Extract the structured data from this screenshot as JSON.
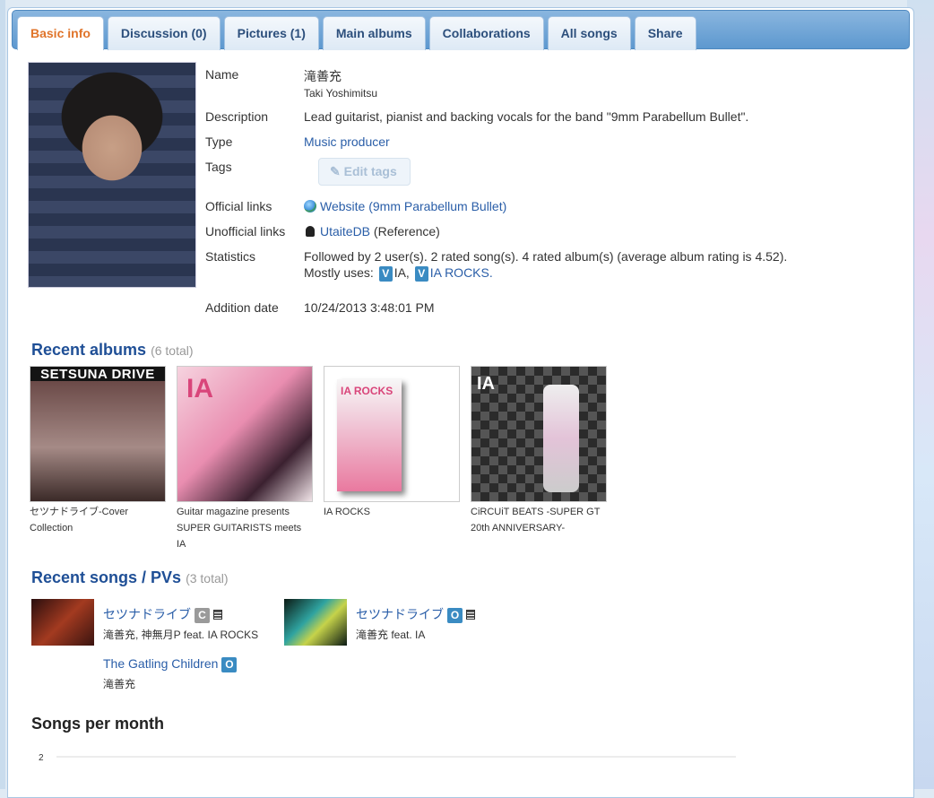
{
  "tabs": [
    "Basic info",
    "Discussion (0)",
    "Pictures (1)",
    "Main albums",
    "Collaborations",
    "All songs",
    "Share"
  ],
  "info": {
    "name_label": "Name",
    "name": "滝善充",
    "name_romaji": "Taki Yoshimitsu",
    "description_label": "Description",
    "description": "Lead guitarist, pianist and backing vocals for the band \"9mm Parabellum Bullet\".",
    "type_label": "Type",
    "type": "Music producer",
    "tags_label": "Tags",
    "edit_tags": "Edit tags",
    "official_links_label": "Official links",
    "official_link": "Website (9mm Parabellum Bullet)",
    "unofficial_links_label": "Unofficial links",
    "unofficial_link": "UtaiteDB",
    "unofficial_link_note": "(Reference)",
    "statistics_label": "Statistics",
    "statistics": "Followed by 2 user(s). 2 rated song(s). 4 rated album(s) (average album rating is 4.52).",
    "mostly_uses_label": "Mostly uses:",
    "voicebank_badge": "V",
    "mostly_uses_1": "IA,",
    "mostly_uses_2": "IA ROCKS.",
    "addition_date_label": "Addition date",
    "addition_date": "10/24/2013 3:48:01 PM"
  },
  "recent_albums": {
    "title": "Recent albums",
    "count": "(6 total)",
    "items": [
      {
        "title": "セツナドライブ-Cover Collection",
        "cover_text": "SETSUNA DRIVE",
        "cover_color": "#3a2a2a"
      },
      {
        "title": "Guitar magazine presents SUPER GUITARISTS meets IA",
        "cover_text": "IA",
        "cover_color": "#e8b9c8"
      },
      {
        "title": "IA ROCKS",
        "cover_text": "IA ROCKS",
        "cover_color": "#f2f2f2"
      },
      {
        "title": "CiRCUiT BEATS -SUPER GT 20th ANNIVERSARY-",
        "cover_text": "IA",
        "cover_color": "#1c1c1c"
      }
    ]
  },
  "recent_songs": {
    "title": "Recent songs / PVs",
    "count": "(3 total)",
    "items": [
      {
        "title": "セツナドライブ",
        "badge": "C",
        "badge_color": "#9a9a9a",
        "artist": "滝善充, 神無月P feat. IA ROCKS"
      },
      {
        "title": "セツナドライブ",
        "badge": "O",
        "badge_color": "#3a8bc2",
        "artist": "滝善充 feat. IA"
      },
      {
        "title": "The Gatling Children",
        "badge": "O",
        "badge_color": "#3a8bc2",
        "artist": "滝善充"
      }
    ]
  },
  "songs_per_month": {
    "title": "Songs per month"
  },
  "chart_data": {
    "type": "bar",
    "title": "Songs per month",
    "categories": [],
    "values": [],
    "ytick_labels": [
      "2"
    ],
    "ylim": [
      0,
      2
    ],
    "grid": true
  },
  "colors": {
    "link": "#2a5ea8",
    "active_tab": "#e0742a",
    "section_title": "#1f4f96",
    "tab_bar": "#5d98cf"
  }
}
